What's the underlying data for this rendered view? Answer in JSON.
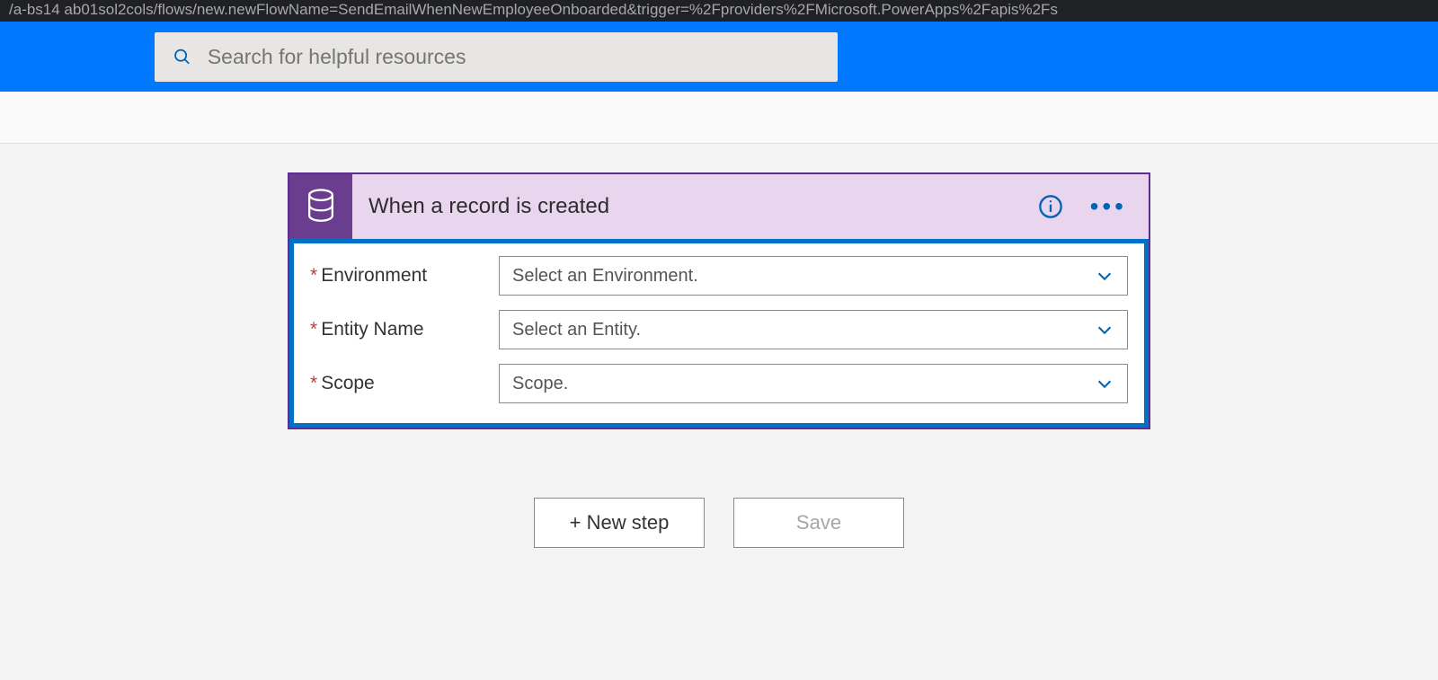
{
  "url_fragment": "/a-bs14 ab01sol2cols/flows/new.newFlowName=SendEmailWhenNewEmployeeOnboarded&trigger=%2Fproviders%2FMicrosoft.PowerApps%2Fapis%2Fs",
  "search": {
    "placeholder": "Search for helpful resources"
  },
  "trigger": {
    "title": "When a record is created",
    "fields": [
      {
        "label": "Environment",
        "placeholder": "Select an Environment."
      },
      {
        "label": "Entity Name",
        "placeholder": "Select an Entity."
      },
      {
        "label": "Scope",
        "placeholder": "Scope."
      }
    ]
  },
  "buttons": {
    "new_step": "+ New step",
    "save": "Save"
  }
}
